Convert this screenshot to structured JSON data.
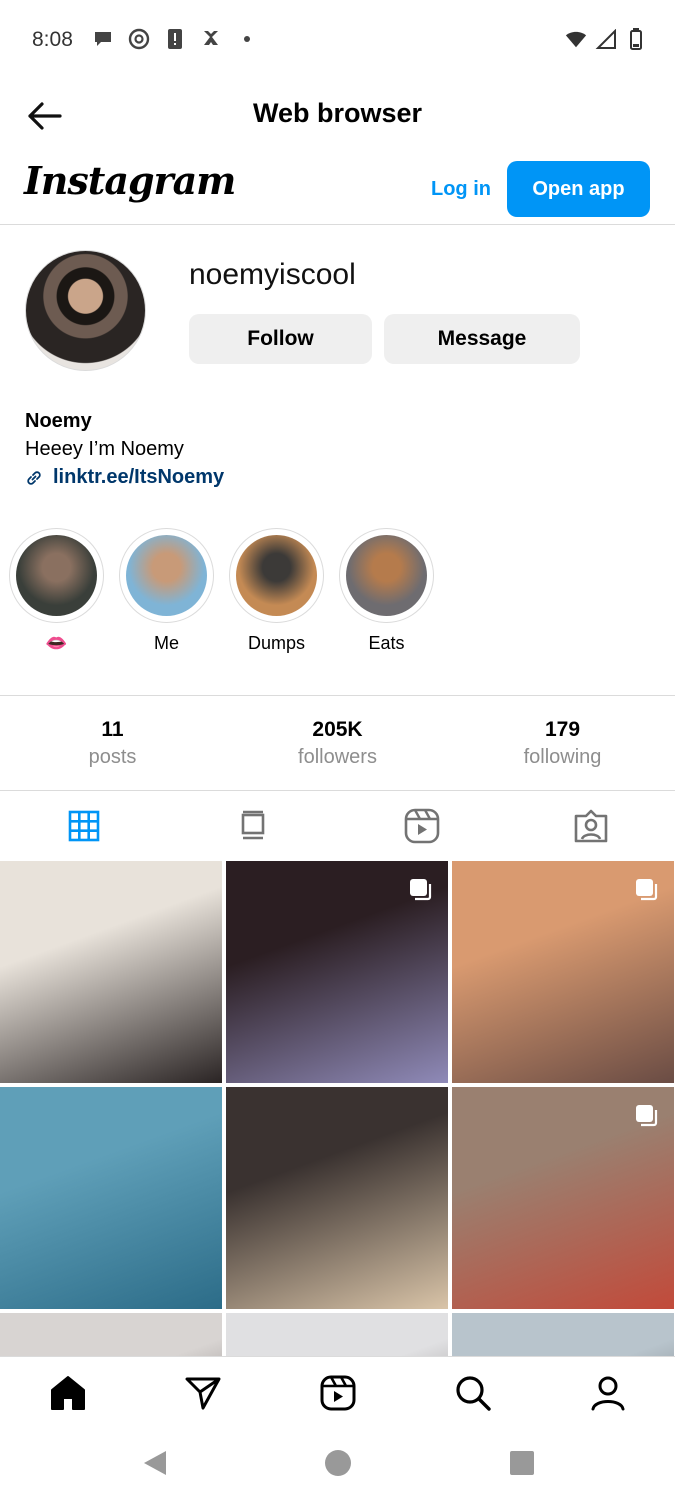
{
  "status": {
    "time": "8:08"
  },
  "app_bar": {
    "title": "Web browser"
  },
  "ig_header": {
    "logo": "Instagram",
    "login": "Log in",
    "open_app": "Open app"
  },
  "profile": {
    "username": "noemyiscool",
    "follow": "Follow",
    "message": "Message",
    "display_name": "Noemy",
    "bio": "Heeey I’m Noemy",
    "link": "linktr.ee/ItsNoemy"
  },
  "highlights": [
    {
      "label": "👄",
      "colors": [
        "#3a3f3a",
        "#8a7060"
      ]
    },
    {
      "label": "Me",
      "colors": [
        "#7fb4d6",
        "#c89a78"
      ]
    },
    {
      "label": "Dumps",
      "colors": [
        "#c48a54",
        "#3c3a38"
      ]
    },
    {
      "label": "Eats",
      "colors": [
        "#6e6c70",
        "#b57b4c"
      ]
    }
  ],
  "stats": [
    {
      "num": "11",
      "label": "posts"
    },
    {
      "num": "205K",
      "label": "followers"
    },
    {
      "num": "179",
      "label": "following"
    }
  ],
  "posts": [
    {
      "colors": [
        "#e8e2da",
        "#2a2424"
      ],
      "multi": false
    },
    {
      "colors": [
        "#2b1e22",
        "#8f8ab8"
      ],
      "multi": true
    },
    {
      "colors": [
        "#d99a70",
        "#6a4c44"
      ],
      "multi": true
    },
    {
      "colors": [
        "#5f9fb8",
        "#2c6c88"
      ],
      "multi": false
    },
    {
      "colors": [
        "#3a3230",
        "#d9c4a8"
      ],
      "multi": false
    },
    {
      "colors": [
        "#9a8070",
        "#c24a3a"
      ],
      "multi": true
    },
    {
      "colors": [
        "#d8d4d2",
        "#2a2220"
      ],
      "multi": false
    },
    {
      "colors": [
        "#e0e0e2",
        "#3a3432"
      ],
      "multi": false
    },
    {
      "colors": [
        "#b8c4cc",
        "#2c2c2e"
      ],
      "multi": false
    }
  ],
  "colors": {
    "accent": "#0095f6",
    "link": "#00376b",
    "muted": "#8e8e8e"
  }
}
